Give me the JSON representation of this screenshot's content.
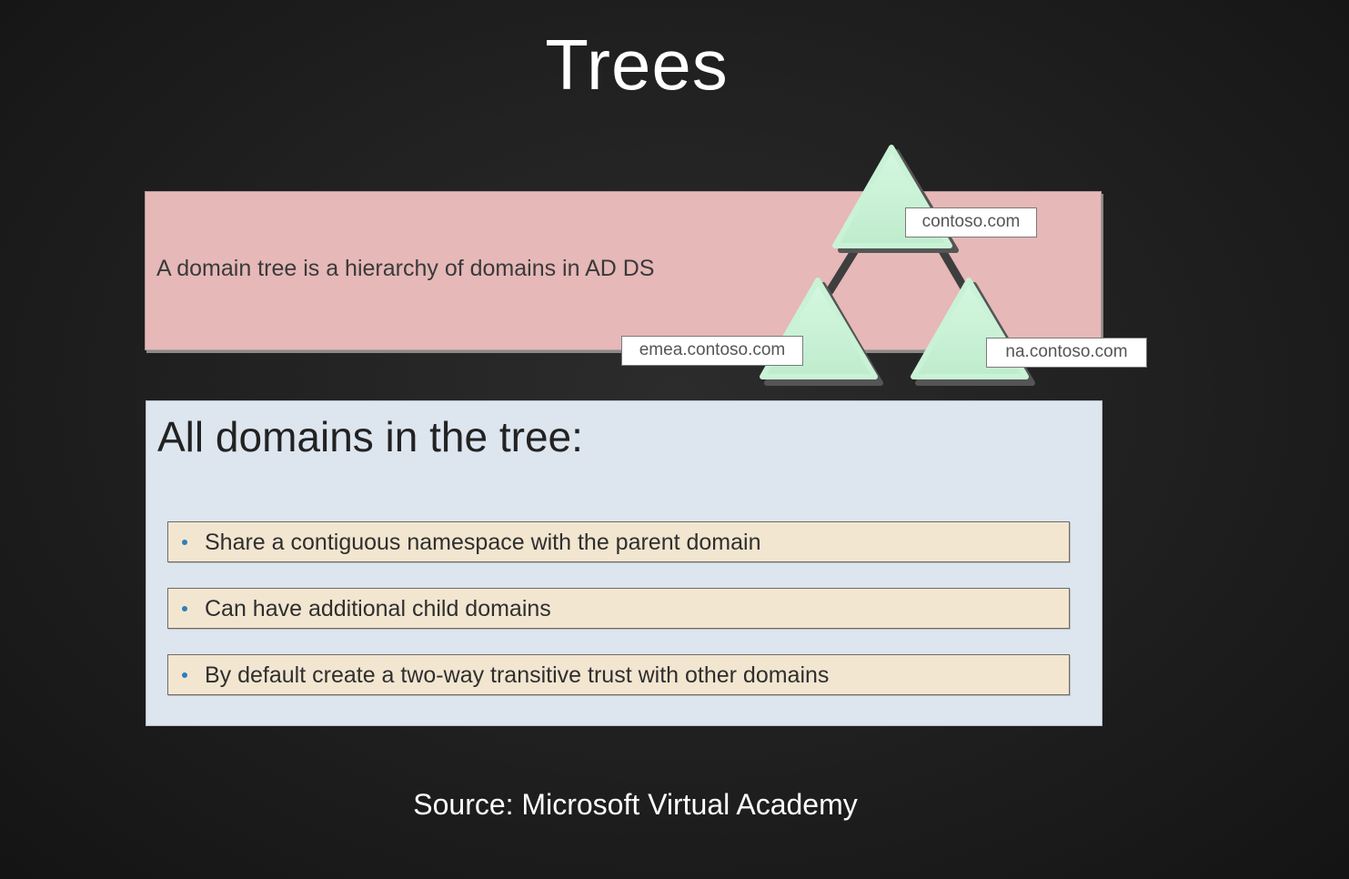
{
  "slide": {
    "title": "Trees",
    "definition": "A domain tree is a hierarchy of domains in AD DS",
    "domains_heading": "All domains in the tree:",
    "bullets": [
      "Share a contiguous namespace with the parent domain",
      "Can have additional child domains",
      "By default create a two-way transitive trust with other domains"
    ]
  },
  "tree": {
    "root_domain": "contoso.com",
    "child_domains": [
      "emea.contoso.com",
      "na.contoso.com"
    ],
    "node_color": "#c9f2d6"
  },
  "footer": {
    "source": "Source: Microsoft Virtual Academy"
  }
}
